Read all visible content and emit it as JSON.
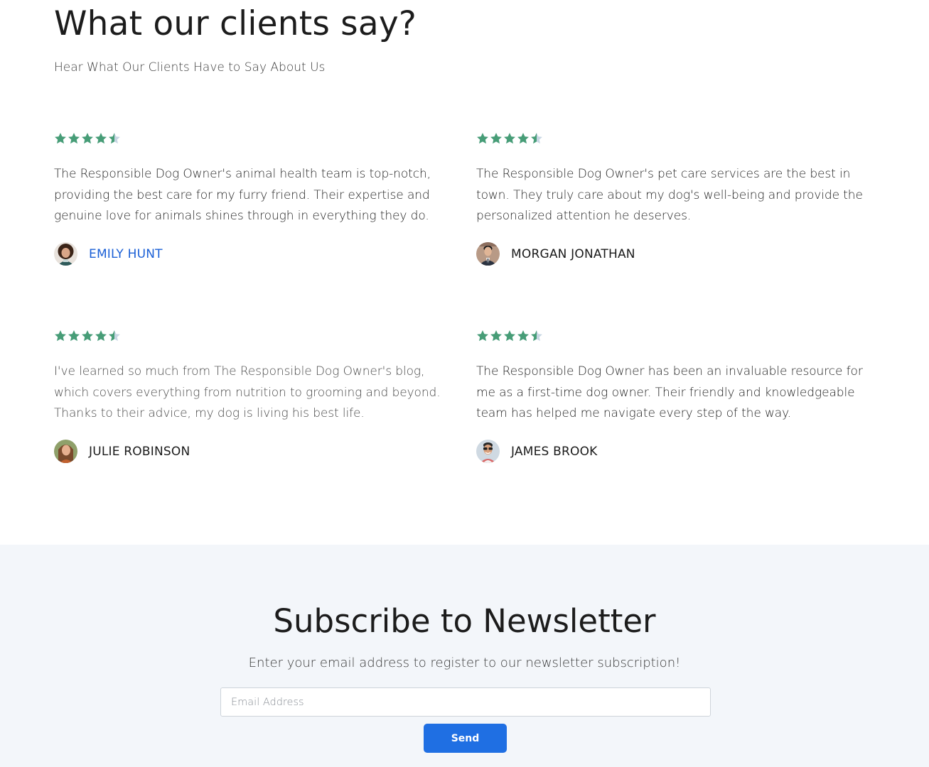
{
  "testimonials": {
    "title": "What our clients say?",
    "subtitle": "Hear What Our Clients Have to Say About Us",
    "star_color": "#479d77",
    "star_empty_color": "#c7d6e3",
    "items": [
      {
        "rating": 4.5,
        "quote": "The Responsible Dog Owner's animal health team is top-notch, providing the best care for my furry friend. Their expertise and genuine love for animals shines through in everything they do.",
        "author": "EMILY HUNT",
        "avatar_icon": "avatar-woman-curly-hair"
      },
      {
        "rating": 4.5,
        "quote": "The Responsible Dog Owner's pet care services are the best in town. They truly care about my dog's well-being and provide the personalized attention he deserves.",
        "author": "MORGAN JONATHAN",
        "avatar_icon": "avatar-man-suit"
      },
      {
        "rating": 4.5,
        "quote": "I've learned so much from The Responsible Dog Owner's blog, which covers everything from nutrition to grooming and beyond. Thanks to their advice, my dog is living his best life.",
        "author": "JULIE ROBINSON",
        "avatar_icon": "avatar-woman-long-hair"
      },
      {
        "rating": 4.5,
        "quote": "The Responsible Dog Owner has been an invaluable resource for me as a first-time dog owner. Their friendly and knowledgeable team has helped me navigate every step of the way.",
        "author": "JAMES BROOK",
        "avatar_icon": "avatar-man-glasses"
      }
    ]
  },
  "newsletter": {
    "title": "Subscribe to Newsletter",
    "subtitle": "Enter your email address to register to our newsletter subscription!",
    "email_placeholder": "Email Address",
    "email_value": "",
    "send_label": "Send",
    "button_color": "#1f6fe3",
    "background_color": "#f3f6fa"
  }
}
